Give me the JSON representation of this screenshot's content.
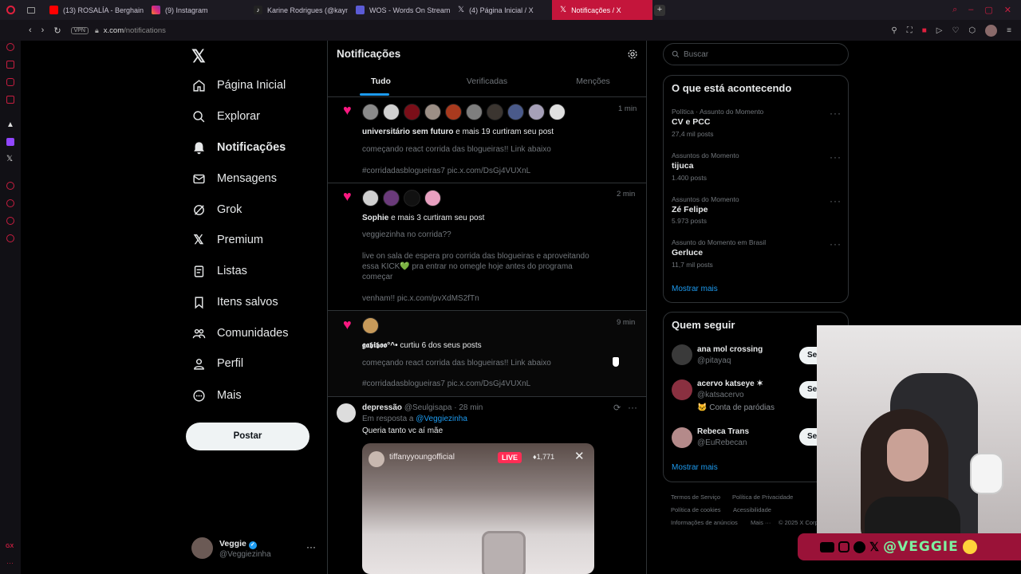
{
  "browser": {
    "tabs": [
      {
        "label": "(13) ROSALÍA - Berghain (",
        "icon": "youtube-icon",
        "color": "#ff0000"
      },
      {
        "label": "(9) Instagram",
        "icon": "instagram-icon",
        "color": "#e1306c"
      },
      {
        "label": "Karine Rodrigues (@kayn",
        "icon": "tiktok-icon",
        "color": "#ffffff"
      },
      {
        "label": "WOS - Words On Stream",
        "icon": "wos-icon",
        "color": "#5b5bd6"
      },
      {
        "label": "(4) Página Inicial / X",
        "icon": "x-icon",
        "color": "#ffffff"
      },
      {
        "label": "Notificações / X",
        "icon": "x-icon",
        "color": "#ffffff"
      }
    ],
    "url_host": "x.com",
    "url_path": "/notifications",
    "vpn_label": "VPN"
  },
  "nav": {
    "items": [
      {
        "label": "Página Inicial",
        "icon": "home-icon"
      },
      {
        "label": "Explorar",
        "icon": "search-icon"
      },
      {
        "label": "Notificações",
        "icon": "bell-icon"
      },
      {
        "label": "Mensagens",
        "icon": "mail-icon"
      },
      {
        "label": "Grok",
        "icon": "grok-icon"
      },
      {
        "label": "Premium",
        "icon": "x-premium-icon"
      },
      {
        "label": "Listas",
        "icon": "list-icon"
      },
      {
        "label": "Itens salvos",
        "icon": "bookmark-icon"
      },
      {
        "label": "Comunidades",
        "icon": "communities-icon"
      },
      {
        "label": "Perfil",
        "icon": "person-icon"
      },
      {
        "label": "Mais",
        "icon": "more-circle-icon"
      }
    ],
    "post_button": "Postar",
    "account": {
      "name": "Veggie",
      "handle": "@Veggiezinha"
    }
  },
  "main": {
    "title": "Notificações",
    "tabs": [
      "Tudo",
      "Verificadas",
      "Menções"
    ],
    "notifications": [
      {
        "time": "1 min",
        "actor": "universitário sem futuro",
        "action": " e mais 19 curtiram seu post",
        "lines": [
          "começando react corrida das blogueiras!! Link abaixo",
          "#corridadasblogueiras7 pic.x.com/DsGj4VUXnL"
        ],
        "avatars": [
          "#8a8a8a",
          "#d0d0d0",
          "#7a0e18",
          "#9c8f86",
          "#a83a1e",
          "#7e7e7e",
          "#3b3530",
          "#4a5a8a",
          "#a6a0b8",
          "#e0e0e0"
        ]
      },
      {
        "time": "2 min",
        "actor": "Sophie",
        "action": " e mais 3 curtiram seu post",
        "lines": [
          "veggiezinha no corrida??",
          "live on sala de espera pro corrida das blogueiras e aproveitando",
          "essa KICK💚 pra entrar no omegle hoje antes do programa",
          "começar",
          "venham!! pic.x.com/pvXdMS2fTn"
        ],
        "avatars": [
          "#cfcfcf",
          "#6a3a7a",
          "#111111",
          "#e8a0c0"
        ]
      },
      {
        "time": "9 min",
        "actor": "𝖌𝖆𝖇𝖎𝖇𝖔𝖔°^•",
        "action": " curtiu 6 dos seus posts",
        "lines": [
          "começando react corrida das blogueiras!! Link abaixo",
          "#corridadasblogueiras7 pic.x.com/DsGj4VUXnL"
        ],
        "avatars": [
          "#c79a5a"
        ]
      }
    ],
    "reply": {
      "name": "depressão",
      "handle": "@Seulgisapa",
      "time": "· 28 min",
      "in_reply_prefix": "Em resposta a ",
      "in_reply_handle": "@Veggiezinha",
      "text": "Queria tanto vc aí mãe",
      "media_overlay": "tiffanyyoungofficial",
      "media_live": "LIVE",
      "media_viewers": "♦1,771"
    }
  },
  "right": {
    "search_placeholder": "Buscar",
    "trends_title": "O que está acontecendo",
    "trends": [
      {
        "category": "Política · Assunto do Momento",
        "name": "CV e PCC",
        "count": "27,4 mil posts"
      },
      {
        "category": "Assuntos do Momento",
        "name": "tijuca",
        "count": "1.400 posts"
      },
      {
        "category": "Assuntos do Momento",
        "name": "Zé Felipe",
        "count": "5.973 posts"
      },
      {
        "category": "Assunto do Momento em Brasil",
        "name": "Gerluce",
        "count": "11,7 mil posts"
      }
    ],
    "show_more": "Mostrar mais",
    "follow_title": "Quem seguir",
    "follow": [
      {
        "name": "ana mol crossing",
        "handle": "@pitayaq",
        "note": "",
        "button": "Se"
      },
      {
        "name": "acervo katseye ✶",
        "handle": "@katsacervo",
        "note": "🐱 Conta de paródias",
        "button": "Se"
      },
      {
        "name": "Rebeca Trans",
        "handle": "@EuRebecan",
        "note": "",
        "button": "Se"
      }
    ],
    "show_more2": "Mostrar mais",
    "footer": [
      "Termos de Serviço",
      "Política de Privacidade",
      "Política de cookies",
      "Acessibilidade",
      "Informações de anúncios",
      "Mais ···",
      "© 2025 X Corp."
    ]
  },
  "stream_overlay": {
    "handle_text": "@VEGGIE"
  }
}
